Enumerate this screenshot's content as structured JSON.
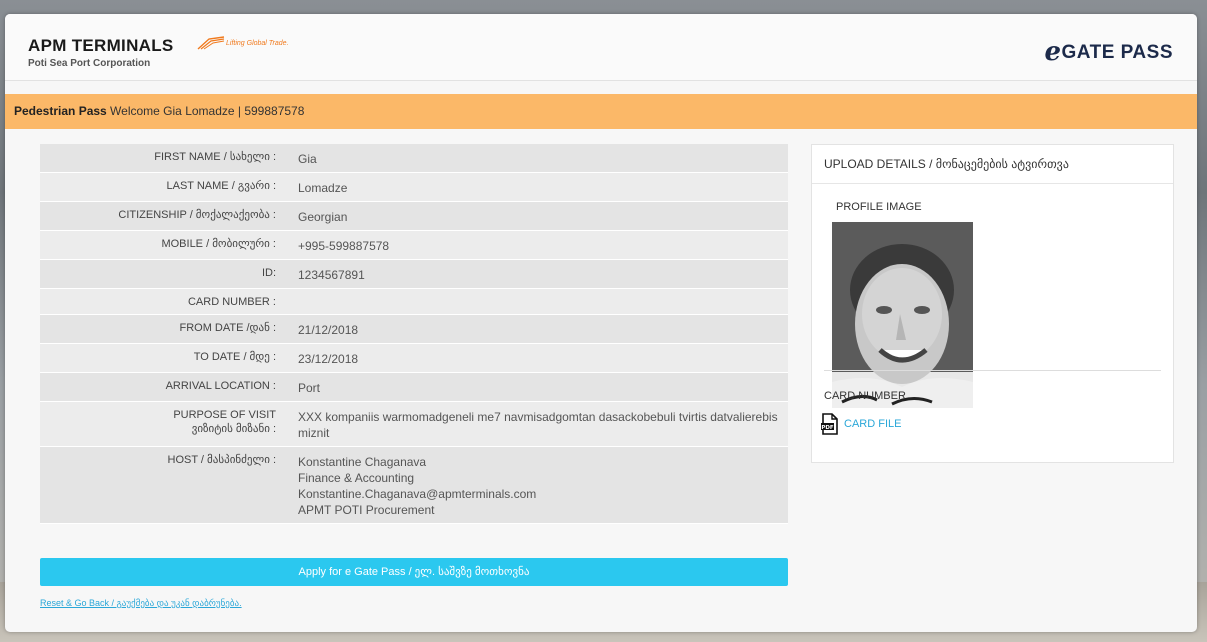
{
  "header": {
    "logo_name": "APM TERMINALS",
    "logo_tagline": "Lifting Global Trade.",
    "logo_subtitle": "Poti Sea Port Corporation",
    "brand_e": "e",
    "brand_text": "GATE PASS"
  },
  "welcome": {
    "pass_type": "Pedestrian Pass",
    "message": " Welcome Gia Lomadze | 599887578"
  },
  "fields": [
    {
      "label": "FIRST NAME / სახელი :",
      "value": [
        "Gia"
      ]
    },
    {
      "label": "LAST NAME / გვარი :",
      "value": [
        "Lomadze"
      ]
    },
    {
      "label": "CITIZENSHIP / მოქალაქეობა :",
      "value": [
        "Georgian"
      ]
    },
    {
      "label": "MOBILE / მობილური :",
      "value": [
        "+995-599887578"
      ]
    },
    {
      "label": "ID:",
      "value": [
        "1234567891"
      ]
    },
    {
      "label": "CARD NUMBER :",
      "value": [
        ""
      ]
    },
    {
      "label": "FROM DATE /დან :",
      "value": [
        "21/12/2018"
      ]
    },
    {
      "label": "TO DATE / მდე :",
      "value": [
        "23/12/2018"
      ]
    },
    {
      "label": "ARRIVAL LOCATION :",
      "value": [
        "Port"
      ]
    },
    {
      "label": "PURPOSE OF VISIT\nვიზიტის მიზანი :",
      "value": [
        "XXX kompaniis warmomadgeneli me7 navmisadgomtan dasackobebuli tvirtis datvalierebis miznit"
      ]
    },
    {
      "label": "HOST / მასპინძელი :",
      "value": [
        "Konstantine Chaganava",
        "Finance & Accounting",
        "Konstantine.Chaganava@apmterminals.com",
        "APMT POTI Procurement"
      ]
    }
  ],
  "actions": {
    "apply_label": "Apply for e Gate Pass / ელ. საშვზე მოთხოვნა",
    "reset_label": "Reset & Go Back / გაუქმება და უკან დაბრუნება."
  },
  "upload": {
    "title": "UPLOAD DETAILS / მონაცემების ატვირთვა",
    "profile_image_label": "PROFILE IMAGE",
    "card_number_label": "CARD NUMBER",
    "card_file_label": "CARD FILE",
    "card_file_icon": "pdf-file-icon"
  },
  "colors": {
    "welcome_bar": "#fbb868",
    "apply_button": "#2bc8ef",
    "link": "#2aa7d8",
    "logo_accent": "#f07a1e"
  }
}
